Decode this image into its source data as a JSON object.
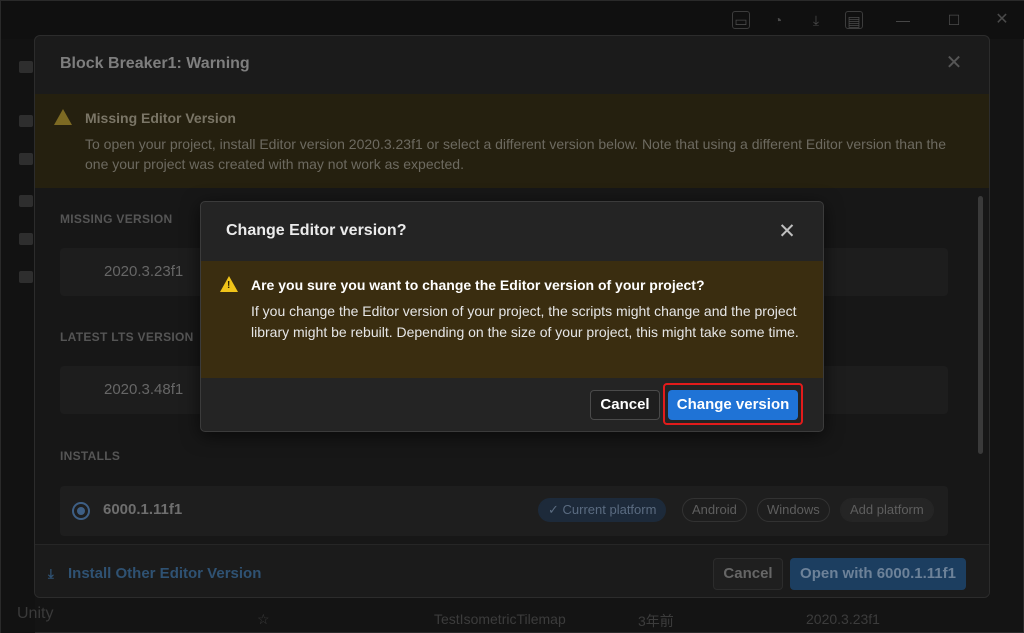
{
  "titlebar": {
    "icons": [
      "layout-icon",
      "sync-icon",
      "download-icon",
      "account-icon",
      "minimize-icon",
      "maximize-icon",
      "close-icon"
    ]
  },
  "hub": {
    "app_label": "Unity",
    "background_row": {
      "project_name": "TestIsometricTilemap",
      "modified": "3年前",
      "editor_version": "2020.3.23f1"
    }
  },
  "warning_dialog": {
    "title": "Block Breaker1: Warning",
    "banner_heading": "Missing Editor Version",
    "banner_body": "To open your project, install Editor version 2020.3.23f1 or select a different version below. Note that using a different Editor version than the one your project was created with may not work as expected.",
    "missing_version_label": "MISSING VERSION",
    "missing_version_value": "2020.3.23f1",
    "latest_lts_label": "LATEST LTS VERSION",
    "latest_lts_value": "2020.3.48f1",
    "installs_label": "INSTALLS",
    "install": {
      "version": "6000.1.11f1",
      "chips": {
        "current": "Current platform",
        "android": "Android",
        "windows": "Windows",
        "add": "Add platform"
      }
    },
    "footer": {
      "install_other": "Install Other Editor Version",
      "cancel": "Cancel",
      "open": "Open with 6000.1.11f1"
    }
  },
  "change_dialog": {
    "title": "Change Editor version?",
    "heading": "Are you sure you want to change the Editor version of your project?",
    "body": "If you change the Editor version of your project, the scripts might change and the project library might be rebuilt. Depending on the size of your project, this might take some time.",
    "cancel": "Cancel",
    "confirm": "Change version"
  },
  "colors": {
    "accent_blue": "#1f73d6",
    "warning_yellow": "#f0c419",
    "highlight_red": "#e21b1b"
  }
}
